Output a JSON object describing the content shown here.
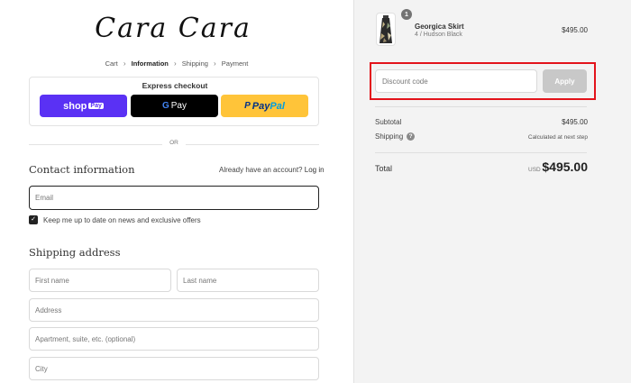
{
  "brand": {
    "logo_text": "Cara Cara"
  },
  "breadcrumb": {
    "items": [
      {
        "label": "Cart",
        "active": false
      },
      {
        "label": "Information",
        "active": true
      },
      {
        "label": "Shipping",
        "active": false
      },
      {
        "label": "Payment",
        "active": false
      }
    ]
  },
  "express": {
    "title": "Express checkout",
    "shop_label": "shop",
    "shop_pay_label": "Pay",
    "gpay_g": "G",
    "gpay_label": "Pay",
    "paypal_icon": "P",
    "paypal_pay": "Pay",
    "paypal_pal": "Pal"
  },
  "divider_text": "OR",
  "contact": {
    "title": "Contact information",
    "account_prompt": "Already have an account?",
    "login_link": "Log in",
    "email_placeholder": "Email",
    "newsletter_label": "Keep me up to date on news and exclusive offers",
    "newsletter_checked": true
  },
  "shipping": {
    "title": "Shipping address",
    "first_name_placeholder": "First name",
    "last_name_placeholder": "Last name",
    "address_placeholder": "Address",
    "apartment_placeholder": "Apartment, suite, etc. (optional)",
    "city_placeholder": "City"
  },
  "order": {
    "item": {
      "quantity": "1",
      "name": "Georgica Skirt",
      "variant": "4 / Hudson Black",
      "price": "$495.00"
    },
    "discount_placeholder": "Discount code",
    "apply_label": "Apply",
    "subtotal_label": "Subtotal",
    "subtotal_value": "$495.00",
    "shipping_label": "Shipping",
    "shipping_value": "Calculated at next step",
    "total_label": "Total",
    "total_currency": "USD",
    "total_value": "$495.00"
  },
  "colors": {
    "shop_pay": "#5a31f4",
    "paypal": "#ffc439",
    "highlight": "#e3131b"
  }
}
